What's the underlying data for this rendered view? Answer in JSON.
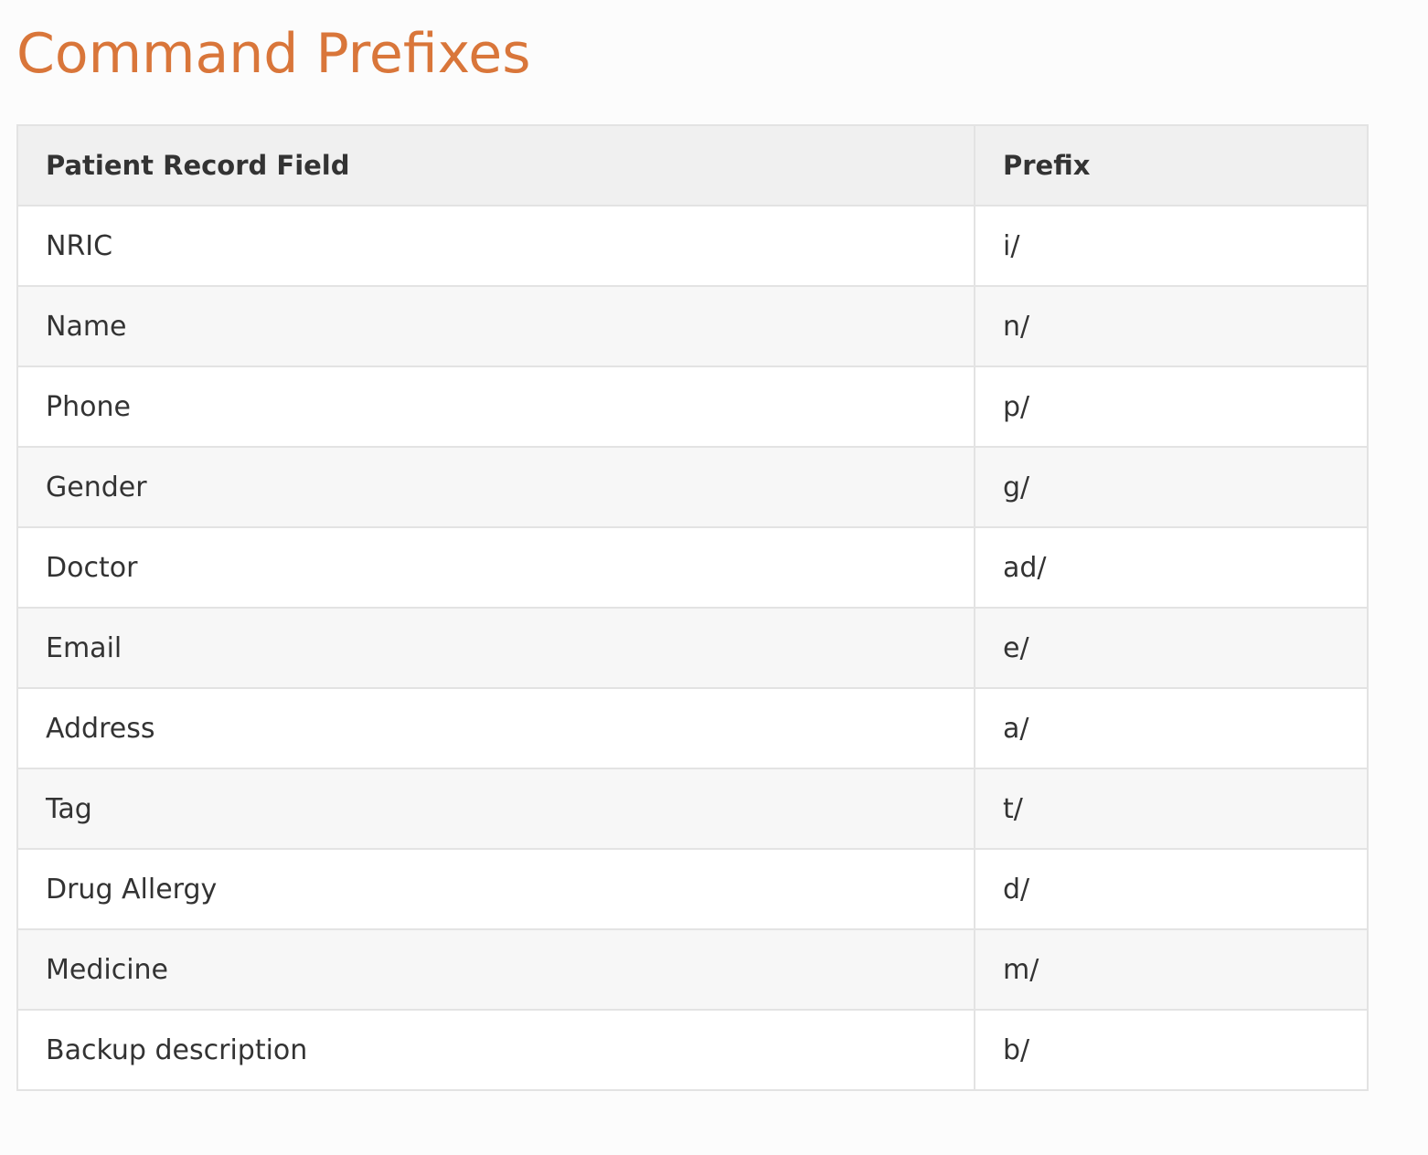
{
  "page": {
    "title": "Command Prefixes"
  },
  "table": {
    "headers": {
      "field": "Patient Record Field",
      "prefix": "Prefix"
    },
    "rows": [
      {
        "field": "NRIC",
        "prefix": "i/"
      },
      {
        "field": "Name",
        "prefix": "n/"
      },
      {
        "field": "Phone",
        "prefix": "p/"
      },
      {
        "field": "Gender",
        "prefix": "g/"
      },
      {
        "field": "Doctor",
        "prefix": "ad/"
      },
      {
        "field": "Email",
        "prefix": "e/"
      },
      {
        "field": "Address",
        "prefix": "a/"
      },
      {
        "field": "Tag",
        "prefix": "t/"
      },
      {
        "field": "Drug Allergy",
        "prefix": "d/"
      },
      {
        "field": "Medicine",
        "prefix": "m/"
      },
      {
        "field": "Backup description",
        "prefix": "b/"
      }
    ]
  },
  "colors": {
    "title": "#d9763a",
    "header_bg": "#f0f0f0",
    "row_odd_bg": "#ffffff",
    "row_even_bg": "#f7f7f7",
    "border": "#e3e3e3",
    "text": "#333333"
  }
}
